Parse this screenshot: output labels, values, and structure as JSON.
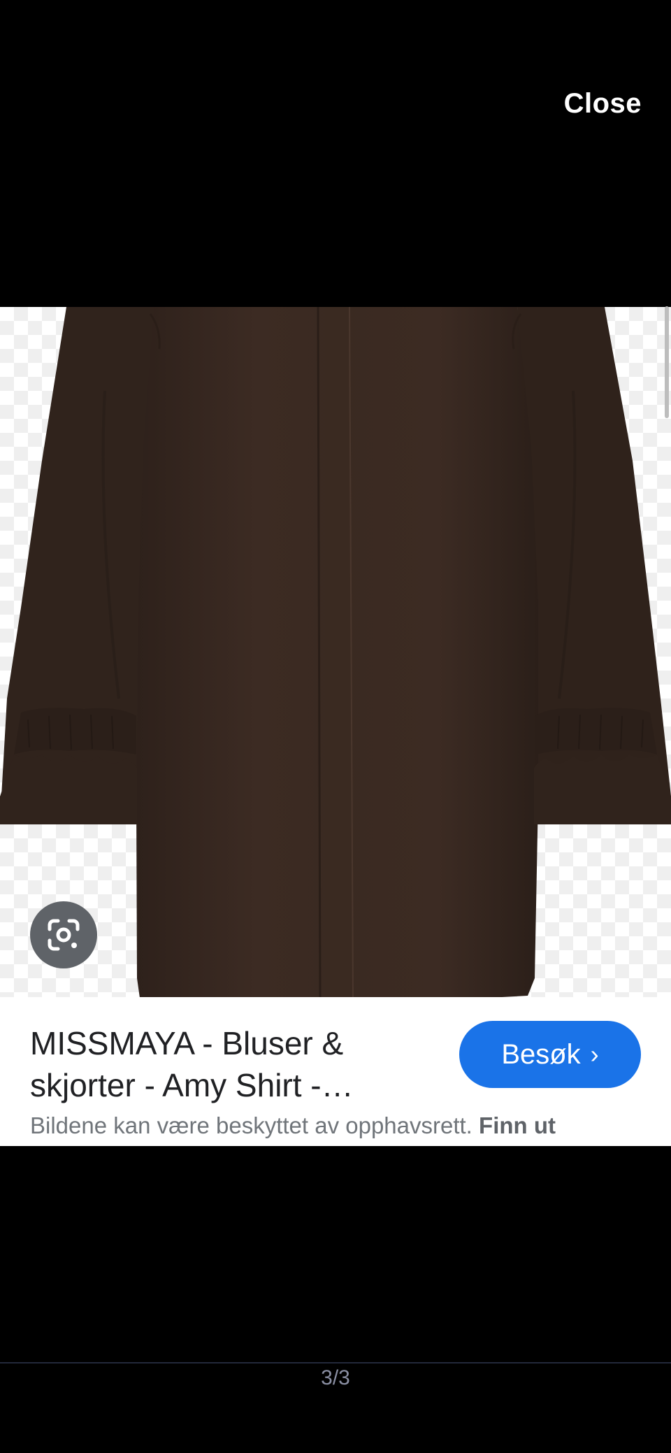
{
  "header": {
    "close_label": "Close"
  },
  "image": {
    "description_icon": "google-lens-icon"
  },
  "result": {
    "title": "MISSMAYA - Bluser & skjorter - Amy Shirt -…",
    "visit_label": "Besøk",
    "visit_chevron": "›",
    "copyright_text": "Bildene kan være beskyttet av opphavsrett.",
    "learn_more": "Finn ut"
  },
  "pagination": {
    "counter": "3/3"
  },
  "colors": {
    "background": "#000000",
    "visit_button": "#1a73e8",
    "garment": "#3a2a22"
  }
}
